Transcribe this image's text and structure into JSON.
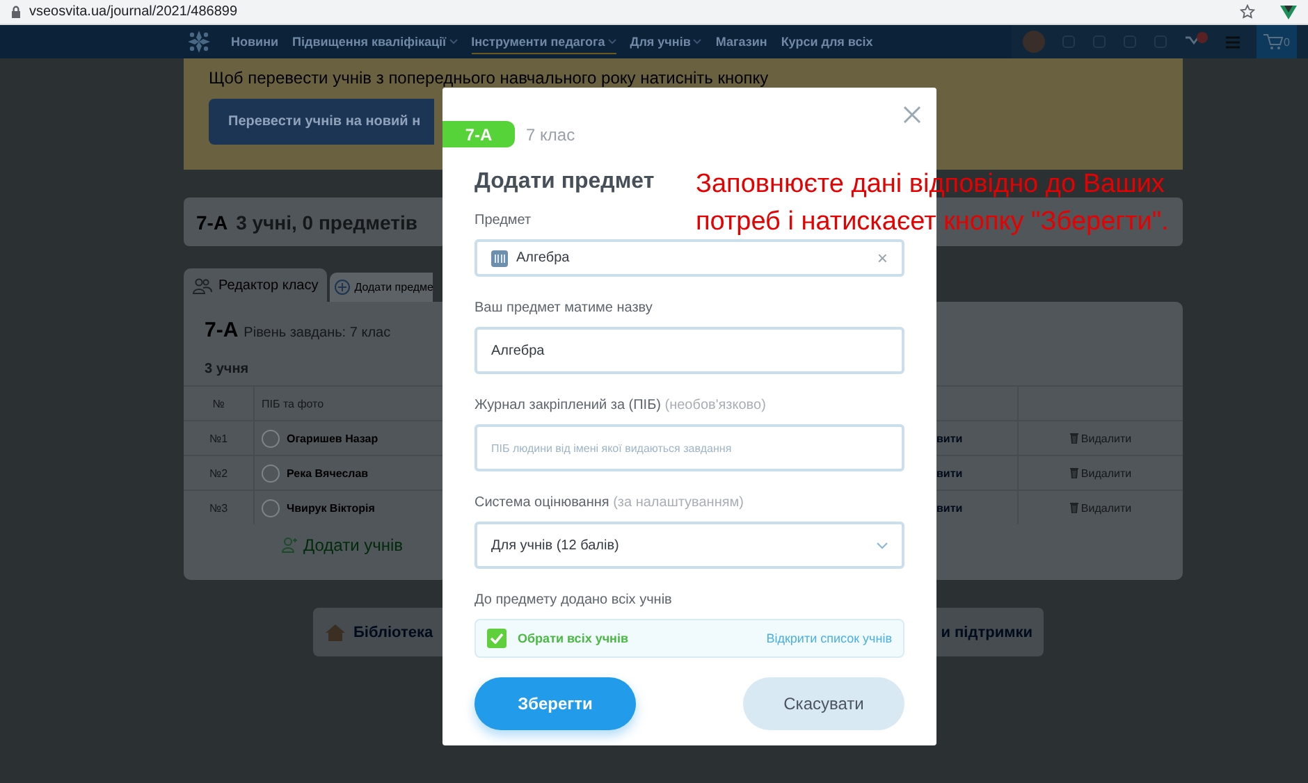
{
  "browser": {
    "url": "vseosvita.ua/journal/2021/486899"
  },
  "nav": {
    "items": [
      {
        "label": "Новини",
        "has_caret": false,
        "selected": false
      },
      {
        "label": "Підвищення кваліфікації",
        "has_caret": true,
        "selected": false
      },
      {
        "label": "Інструменти педагога",
        "has_caret": true,
        "selected": true
      },
      {
        "label": "Для учнів",
        "has_caret": true,
        "selected": false
      },
      {
        "label": "Магазин",
        "has_caret": false,
        "selected": false
      },
      {
        "label": "Курси для всіх",
        "has_caret": false,
        "selected": false
      }
    ],
    "cart_count": "0"
  },
  "banner": {
    "text": "Щоб перевести учнів з попереднього навчального року натисніть кнопку",
    "button": "Перевести учнів на новий н"
  },
  "class_card": {
    "name": "7-А",
    "summary": "3 учні, 0 предметів"
  },
  "tabs": [
    {
      "label": "Редактор класу",
      "selected": true,
      "kind": "people"
    },
    {
      "label": "Додати предме",
      "selected": false,
      "kind": "add"
    }
  ],
  "panel": {
    "class_name": "7-А",
    "level_text": "Рівень завдань: 7 клас",
    "students_count": "3 учня",
    "columns": [
      "№",
      "ПІБ та фото"
    ],
    "rows": [
      {
        "number": "№1",
        "name": "Огаришев Назар",
        "action": "вити",
        "delete": "Видалити"
      },
      {
        "number": "№2",
        "name": "Река Вячеслав",
        "action": "вити",
        "delete": "Видалити"
      },
      {
        "number": "№3",
        "name": "Чвирук Вікторія",
        "action": "вити",
        "delete": "Видалити"
      }
    ],
    "add_button": "Додати учнів"
  },
  "bottom_cards": [
    {
      "label": "Бібліотека",
      "kind": "house"
    },
    {
      "label": "и підтримки",
      "kind": "plain"
    }
  ],
  "modal": {
    "class_tag": "7-А",
    "class_label": "7 клас",
    "title": "Додати предмет",
    "fields": [
      {
        "kind": "combo",
        "label": "Предмет",
        "value": "Алгебра",
        "clear": "×"
      },
      {
        "kind": "text",
        "label": "Ваш предмет матиме назву",
        "value": "Алгебра"
      },
      {
        "kind": "text",
        "label": "Журнал закріплений за (ПІБ)",
        "note": "(необов'язково)",
        "placeholder": "ПІБ людини від імені якої видаються завдання"
      },
      {
        "kind": "select",
        "label": "Система оцінювання",
        "note": "(за налаштуванням)",
        "value": "Для учнів (12 балів)"
      }
    ],
    "students_label": "До предмету додано всіх учнів",
    "select_all": {
      "label": "Обрати всіх учнів",
      "checked": true
    },
    "open_list": "Відкрити список учнів",
    "save": "Зберегти",
    "cancel": "Скасувати"
  },
  "annotation": {
    "lines": [
      "Заповнюєте дані відповідно до Ваших",
      "потреб і натискаєет кнопку \"Зберегти\"."
    ]
  }
}
